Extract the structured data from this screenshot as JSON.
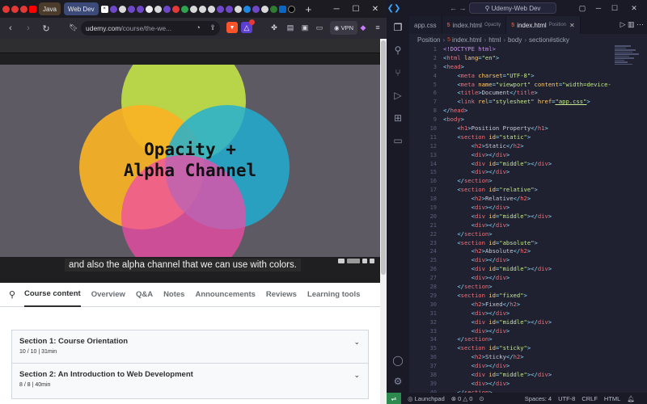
{
  "browser": {
    "tabs": [
      {
        "label": "Java",
        "style": "java"
      },
      {
        "label": "Web Dev",
        "style": "webdev"
      }
    ],
    "url_host": "udemy.com",
    "url_path": "/course/the-we...",
    "vpn_label": "VPN",
    "slide_title_line1": "Opacity +",
    "slide_title_line2": "Alpha Channel",
    "caption": "and also the alpha channel that we can use with colors.",
    "course_tabs": [
      "Course content",
      "Overview",
      "Q&A",
      "Notes",
      "Announcements",
      "Reviews",
      "Learning tools"
    ],
    "sections": [
      {
        "title": "Section 1: Course Orientation",
        "meta": "10 / 10 | 31min"
      },
      {
        "title": "Section 2: An Introduction to Web Development",
        "meta": "8 / 8 | 40min"
      }
    ],
    "colors": {
      "circle_green": "#b8d448",
      "circle_orange": "#f9b224",
      "circle_blue": "#1fb0d6",
      "circle_pink": "#f04ba7",
      "slide_bg": "#5e5a63"
    }
  },
  "vscode": {
    "search_label": "Udemy-Web Dev",
    "tabs": [
      {
        "label": "app.css",
        "hint": "",
        "active": false
      },
      {
        "label": "index.html",
        "hint": "Opacity",
        "active": false
      },
      {
        "label": "index.html",
        "hint": "Position",
        "active": true
      }
    ],
    "breadcrumb": [
      "Position",
      "index.html",
      "html",
      "body",
      "section#sticky"
    ],
    "status": {
      "launchpad": "Launchpad",
      "errors": "0",
      "warnings": "0",
      "spaces": "Spaces: 4",
      "encoding": "UTF-8",
      "eol": "CRLF",
      "language": "HTML"
    },
    "line_numbers": [
      "1",
      "2",
      "3",
      "4",
      "5",
      "6",
      "7",
      "8",
      "9",
      "10",
      "11",
      "12",
      "13",
      "14",
      "15",
      "16",
      "17",
      "18",
      "19",
      "20",
      "21",
      "22",
      "23",
      "24",
      "25",
      "26",
      "27",
      "28",
      "29",
      "30",
      "31",
      "32",
      "33",
      "34",
      "35",
      "36",
      "37",
      "38",
      "39",
      "40"
    ],
    "code": [
      [
        [
          "doc",
          "<!DOCTYPE html>"
        ]
      ],
      [
        [
          "punct",
          "<"
        ],
        [
          "tag",
          "html"
        ],
        [
          "attr",
          " lang"
        ],
        [
          "punct",
          "="
        ],
        [
          "str",
          "\"en\""
        ],
        [
          "punct",
          ">"
        ]
      ],
      [
        [
          "punct",
          "<"
        ],
        [
          "tag",
          "head"
        ],
        [
          "punct",
          ">"
        ]
      ],
      [
        [
          "txt",
          "    "
        ],
        [
          "punct",
          "<"
        ],
        [
          "tag",
          "meta"
        ],
        [
          "attr",
          " charset"
        ],
        [
          "punct",
          "="
        ],
        [
          "str",
          "\"UTF-8\""
        ],
        [
          "punct",
          ">"
        ]
      ],
      [
        [
          "txt",
          "    "
        ],
        [
          "punct",
          "<"
        ],
        [
          "tag",
          "meta"
        ],
        [
          "attr",
          " name"
        ],
        [
          "punct",
          "="
        ],
        [
          "str",
          "\"viewport\""
        ],
        [
          "attr",
          " content"
        ],
        [
          "punct",
          "="
        ],
        [
          "str",
          "\"width=device-"
        ]
      ],
      [
        [
          "txt",
          "    "
        ],
        [
          "punct",
          "<"
        ],
        [
          "tag",
          "title"
        ],
        [
          "punct",
          ">"
        ],
        [
          "txt",
          "Document"
        ],
        [
          "punct",
          "</"
        ],
        [
          "tag",
          "title"
        ],
        [
          "punct",
          ">"
        ]
      ],
      [
        [
          "txt",
          "    "
        ],
        [
          "punct",
          "<"
        ],
        [
          "tag",
          "link"
        ],
        [
          "attr",
          " rel"
        ],
        [
          "punct",
          "="
        ],
        [
          "str",
          "\"stylesheet\""
        ],
        [
          "attr",
          " href"
        ],
        [
          "punct",
          "="
        ],
        [
          "link",
          "\"app.css\""
        ],
        [
          "punct",
          ">"
        ]
      ],
      [
        [
          "punct",
          "</"
        ],
        [
          "tag",
          "head"
        ],
        [
          "punct",
          ">"
        ]
      ],
      [
        [
          "punct",
          "<"
        ],
        [
          "tag",
          "body"
        ],
        [
          "punct",
          ">"
        ]
      ],
      [
        [
          "txt",
          "    "
        ],
        [
          "punct",
          "<"
        ],
        [
          "tag",
          "h1"
        ],
        [
          "punct",
          ">"
        ],
        [
          "txt",
          "Position Property"
        ],
        [
          "punct",
          "</"
        ],
        [
          "tag",
          "h1"
        ],
        [
          "punct",
          ">"
        ]
      ],
      [
        [
          "txt",
          "    "
        ],
        [
          "punct",
          "<"
        ],
        [
          "tag",
          "section"
        ],
        [
          "attr",
          " id"
        ],
        [
          "punct",
          "="
        ],
        [
          "str",
          "\"static\""
        ],
        [
          "punct",
          ">"
        ]
      ],
      [
        [
          "txt",
          "        "
        ],
        [
          "punct",
          "<"
        ],
        [
          "tag",
          "h2"
        ],
        [
          "punct",
          ">"
        ],
        [
          "txt",
          "Static"
        ],
        [
          "punct",
          "</"
        ],
        [
          "tag",
          "h2"
        ],
        [
          "punct",
          ">"
        ]
      ],
      [
        [
          "txt",
          "        "
        ],
        [
          "punct",
          "<"
        ],
        [
          "tag",
          "div"
        ],
        [
          "punct",
          "></"
        ],
        [
          "tag",
          "div"
        ],
        [
          "punct",
          ">"
        ]
      ],
      [
        [
          "txt",
          "        "
        ],
        [
          "punct",
          "<"
        ],
        [
          "tag",
          "div"
        ],
        [
          "attr",
          " id"
        ],
        [
          "punct",
          "="
        ],
        [
          "str",
          "\"middle\""
        ],
        [
          "punct",
          "></"
        ],
        [
          "tag",
          "div"
        ],
        [
          "punct",
          ">"
        ]
      ],
      [
        [
          "txt",
          "        "
        ],
        [
          "punct",
          "<"
        ],
        [
          "tag",
          "div"
        ],
        [
          "punct",
          "></"
        ],
        [
          "tag",
          "div"
        ],
        [
          "punct",
          ">"
        ]
      ],
      [
        [
          "txt",
          "    "
        ],
        [
          "punct",
          "</"
        ],
        [
          "tag",
          "section"
        ],
        [
          "punct",
          ">"
        ]
      ],
      [
        [
          "txt",
          "    "
        ],
        [
          "punct",
          "<"
        ],
        [
          "tag",
          "section"
        ],
        [
          "attr",
          " id"
        ],
        [
          "punct",
          "="
        ],
        [
          "str",
          "\"relative\""
        ],
        [
          "punct",
          ">"
        ]
      ],
      [
        [
          "txt",
          "        "
        ],
        [
          "punct",
          "<"
        ],
        [
          "tag",
          "h2"
        ],
        [
          "punct",
          ">"
        ],
        [
          "txt",
          "Relative"
        ],
        [
          "punct",
          "</"
        ],
        [
          "tag",
          "h2"
        ],
        [
          "punct",
          ">"
        ]
      ],
      [
        [
          "txt",
          "        "
        ],
        [
          "punct",
          "<"
        ],
        [
          "tag",
          "div"
        ],
        [
          "punct",
          "></"
        ],
        [
          "tag",
          "div"
        ],
        [
          "punct",
          ">"
        ]
      ],
      [
        [
          "txt",
          "        "
        ],
        [
          "punct",
          "<"
        ],
        [
          "tag",
          "div"
        ],
        [
          "attr",
          " id"
        ],
        [
          "punct",
          "="
        ],
        [
          "str",
          "\"middle\""
        ],
        [
          "punct",
          "></"
        ],
        [
          "tag",
          "div"
        ],
        [
          "punct",
          ">"
        ]
      ],
      [
        [
          "txt",
          "        "
        ],
        [
          "punct",
          "<"
        ],
        [
          "tag",
          "div"
        ],
        [
          "punct",
          "></"
        ],
        [
          "tag",
          "div"
        ],
        [
          "punct",
          ">"
        ]
      ],
      [
        [
          "txt",
          "    "
        ],
        [
          "punct",
          "</"
        ],
        [
          "tag",
          "section"
        ],
        [
          "punct",
          ">"
        ]
      ],
      [
        [
          "txt",
          "    "
        ],
        [
          "punct",
          "<"
        ],
        [
          "tag",
          "section"
        ],
        [
          "attr",
          " id"
        ],
        [
          "punct",
          "="
        ],
        [
          "str",
          "\"absolute\""
        ],
        [
          "punct",
          ">"
        ]
      ],
      [
        [
          "txt",
          "        "
        ],
        [
          "punct",
          "<"
        ],
        [
          "tag",
          "h2"
        ],
        [
          "punct",
          ">"
        ],
        [
          "txt",
          "Absolute"
        ],
        [
          "punct",
          "</"
        ],
        [
          "tag",
          "h2"
        ],
        [
          "punct",
          ">"
        ]
      ],
      [
        [
          "txt",
          "        "
        ],
        [
          "punct",
          "<"
        ],
        [
          "tag",
          "div"
        ],
        [
          "punct",
          "></"
        ],
        [
          "tag",
          "div"
        ],
        [
          "punct",
          ">"
        ]
      ],
      [
        [
          "txt",
          "        "
        ],
        [
          "punct",
          "<"
        ],
        [
          "tag",
          "div"
        ],
        [
          "attr",
          " id"
        ],
        [
          "punct",
          "="
        ],
        [
          "str",
          "\"middle\""
        ],
        [
          "punct",
          "></"
        ],
        [
          "tag",
          "div"
        ],
        [
          "punct",
          ">"
        ]
      ],
      [
        [
          "txt",
          "        "
        ],
        [
          "punct",
          "<"
        ],
        [
          "tag",
          "div"
        ],
        [
          "punct",
          "></"
        ],
        [
          "tag",
          "div"
        ],
        [
          "punct",
          ">"
        ]
      ],
      [
        [
          "txt",
          "    "
        ],
        [
          "punct",
          "</"
        ],
        [
          "tag",
          "section"
        ],
        [
          "punct",
          ">"
        ]
      ],
      [
        [
          "txt",
          "    "
        ],
        [
          "punct",
          "<"
        ],
        [
          "tag",
          "section"
        ],
        [
          "attr",
          " id"
        ],
        [
          "punct",
          "="
        ],
        [
          "str",
          "\"fixed\""
        ],
        [
          "punct",
          ">"
        ]
      ],
      [
        [
          "txt",
          "        "
        ],
        [
          "punct",
          "<"
        ],
        [
          "tag",
          "h2"
        ],
        [
          "punct",
          ">"
        ],
        [
          "txt",
          "Fixed"
        ],
        [
          "punct",
          "</"
        ],
        [
          "tag",
          "h2"
        ],
        [
          "punct",
          ">"
        ]
      ],
      [
        [
          "txt",
          "        "
        ],
        [
          "punct",
          "<"
        ],
        [
          "tag",
          "div"
        ],
        [
          "punct",
          "></"
        ],
        [
          "tag",
          "div"
        ],
        [
          "punct",
          ">"
        ]
      ],
      [
        [
          "txt",
          "        "
        ],
        [
          "punct",
          "<"
        ],
        [
          "tag",
          "div"
        ],
        [
          "attr",
          " id"
        ],
        [
          "punct",
          "="
        ],
        [
          "str",
          "\"middle\""
        ],
        [
          "punct",
          "></"
        ],
        [
          "tag",
          "div"
        ],
        [
          "punct",
          ">"
        ]
      ],
      [
        [
          "txt",
          "        "
        ],
        [
          "punct",
          "<"
        ],
        [
          "tag",
          "div"
        ],
        [
          "punct",
          "></"
        ],
        [
          "tag",
          "div"
        ],
        [
          "punct",
          ">"
        ]
      ],
      [
        [
          "txt",
          "    "
        ],
        [
          "punct",
          "</"
        ],
        [
          "tag",
          "section"
        ],
        [
          "punct",
          ">"
        ]
      ],
      [
        [
          "txt",
          "    "
        ],
        [
          "punct",
          "<"
        ],
        [
          "tag",
          "section"
        ],
        [
          "attr",
          " id"
        ],
        [
          "punct",
          "="
        ],
        [
          "str",
          "\"sticky\""
        ],
        [
          "punct",
          ">"
        ]
      ],
      [
        [
          "txt",
          "        "
        ],
        [
          "punct",
          "<"
        ],
        [
          "tag",
          "h2"
        ],
        [
          "punct",
          ">"
        ],
        [
          "txt",
          "Sticky"
        ],
        [
          "punct",
          "</"
        ],
        [
          "tag",
          "h2"
        ],
        [
          "punct",
          ">"
        ]
      ],
      [
        [
          "txt",
          "        "
        ],
        [
          "punct",
          "<"
        ],
        [
          "tag",
          "div"
        ],
        [
          "punct",
          "></"
        ],
        [
          "tag",
          "div"
        ],
        [
          "punct",
          ">"
        ]
      ],
      [
        [
          "txt",
          "        "
        ],
        [
          "punct",
          "<"
        ],
        [
          "tag",
          "div"
        ],
        [
          "attr",
          " id"
        ],
        [
          "punct",
          "="
        ],
        [
          "str",
          "\"middle\""
        ],
        [
          "punct",
          "></"
        ],
        [
          "tag",
          "div"
        ],
        [
          "punct",
          ">"
        ]
      ],
      [
        [
          "txt",
          "        "
        ],
        [
          "punct",
          "<"
        ],
        [
          "tag",
          "div"
        ],
        [
          "punct",
          "></"
        ],
        [
          "tag",
          "div"
        ],
        [
          "punct",
          ">"
        ]
      ],
      [
        [
          "txt",
          "    "
        ],
        [
          "punct",
          "</"
        ],
        [
          "tag",
          "section"
        ],
        [
          "punct",
          ">"
        ]
      ]
    ]
  }
}
